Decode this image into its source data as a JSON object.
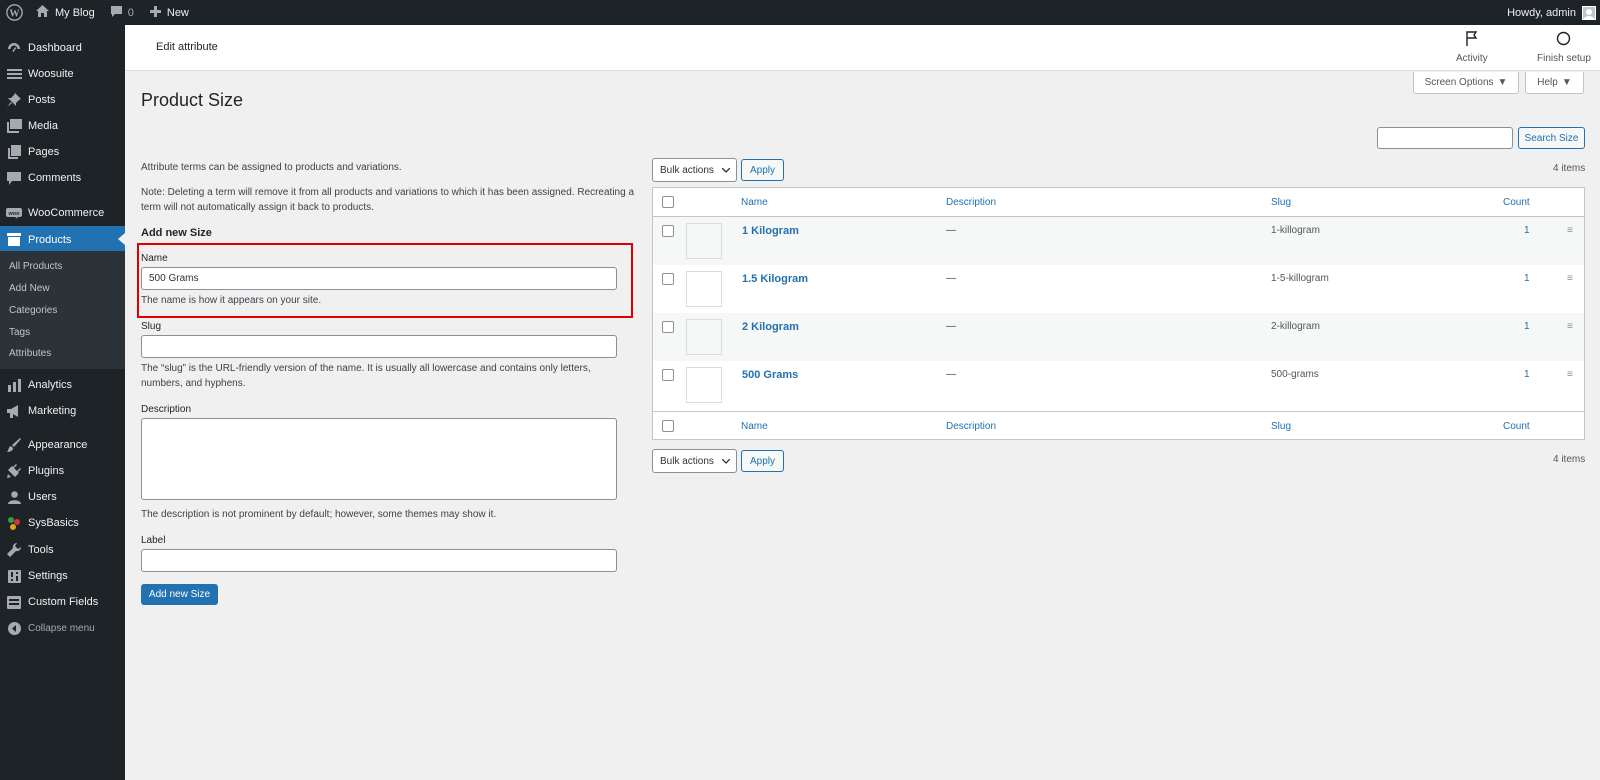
{
  "adminbar": {
    "site_name": "My Blog",
    "comments_count": "0",
    "new_label": "New",
    "howdy": "Howdy, admin"
  },
  "sidebar": {
    "items": [
      {
        "label": "Dashboard",
        "icon": "dashboard-icon"
      },
      {
        "label": "Woosuite",
        "icon": "woosuite-icon"
      },
      {
        "label": "Posts",
        "icon": "pin-icon"
      },
      {
        "label": "Media",
        "icon": "media-icon"
      },
      {
        "label": "Pages",
        "icon": "pages-icon"
      },
      {
        "label": "Comments",
        "icon": "comment-icon"
      },
      {
        "label": "WooCommerce",
        "icon": "woocommerce-icon"
      },
      {
        "label": "Products",
        "icon": "products-icon"
      },
      {
        "label": "Analytics",
        "icon": "analytics-icon"
      },
      {
        "label": "Marketing",
        "icon": "megaphone-icon"
      },
      {
        "label": "Appearance",
        "icon": "brush-icon"
      },
      {
        "label": "Plugins",
        "icon": "plugin-icon"
      },
      {
        "label": "Users",
        "icon": "users-icon"
      },
      {
        "label": "SysBasics",
        "icon": "sysbasics-icon"
      },
      {
        "label": "Tools",
        "icon": "wrench-icon"
      },
      {
        "label": "Settings",
        "icon": "settings-icon"
      },
      {
        "label": "Custom Fields",
        "icon": "fields-icon"
      }
    ],
    "submenu": [
      "All Products",
      "Add New",
      "Categories",
      "Tags",
      "Attributes"
    ],
    "collapse_label": "Collapse menu"
  },
  "header": {
    "title": "Edit attribute",
    "activity": "Activity",
    "finish_setup": "Finish setup",
    "screen_options": "Screen Options",
    "help": "Help"
  },
  "page": {
    "title": "Product Size",
    "search_button": "Search Size",
    "search_value": ""
  },
  "form": {
    "intro": "Attribute terms can be assigned to products and variations.",
    "note_line1": "Note: Deleting a term will remove it from all products and variations to which it has been assigned. Recreating a",
    "note_line2": "term will not automatically assign it back to products.",
    "heading": "Add new Size",
    "name_label": "Name",
    "name_value": "500 Grams",
    "name_help": "The name is how it appears on your site.",
    "slug_label": "Slug",
    "slug_value": "",
    "slug_help_line1": "The “slug” is the URL-friendly version of the name. It is usually all lowercase and contains only letters,",
    "slug_help_line2": "numbers, and hyphens.",
    "description_label": "Description",
    "description_help": "The description is not prominent by default; however, some themes may show it.",
    "label_label": "Label",
    "label_value": "",
    "submit": "Add new Size"
  },
  "table": {
    "bulk_actions": "Bulk actions",
    "apply": "Apply",
    "items_count": "4 items",
    "columns": {
      "name": "Name",
      "description": "Description",
      "slug": "Slug",
      "count": "Count"
    },
    "rows": [
      {
        "name": "1 Kilogram",
        "description": "—",
        "slug": "1-killogram",
        "count": "1"
      },
      {
        "name": "1.5 Kilogram",
        "description": "—",
        "slug": "1-5-killogram",
        "count": "1"
      },
      {
        "name": "2 Kilogram",
        "description": "—",
        "slug": "2-killogram",
        "count": "1"
      },
      {
        "name": "500 Grams",
        "description": "—",
        "slug": "500-grams",
        "count": "1"
      }
    ]
  }
}
